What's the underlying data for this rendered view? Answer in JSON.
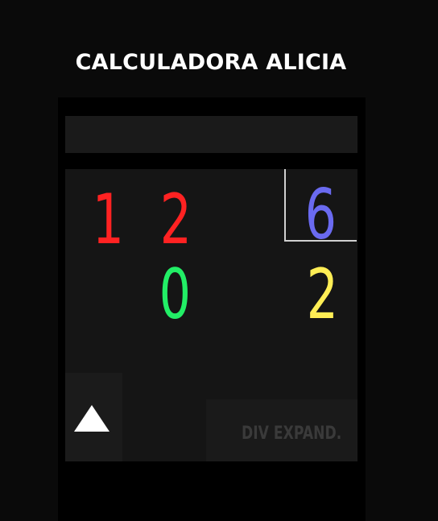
{
  "app": {
    "title": "CALCULADORA ALICIA"
  },
  "display": {
    "value": ""
  },
  "division": {
    "dividend": [
      {
        "value": "1",
        "color": "#ff2222"
      },
      {
        "value": "2",
        "color": "#ff2222"
      }
    ],
    "divisor": {
      "value": "6",
      "color": "#6a6af0"
    },
    "remainder": {
      "value": "0",
      "color": "#22ee66"
    },
    "quotient": {
      "value": "2",
      "color": "#ffee55"
    }
  },
  "controls": {
    "arrow_icon": "triangle-up-icon",
    "expand_label": "DIV EXPAND."
  }
}
